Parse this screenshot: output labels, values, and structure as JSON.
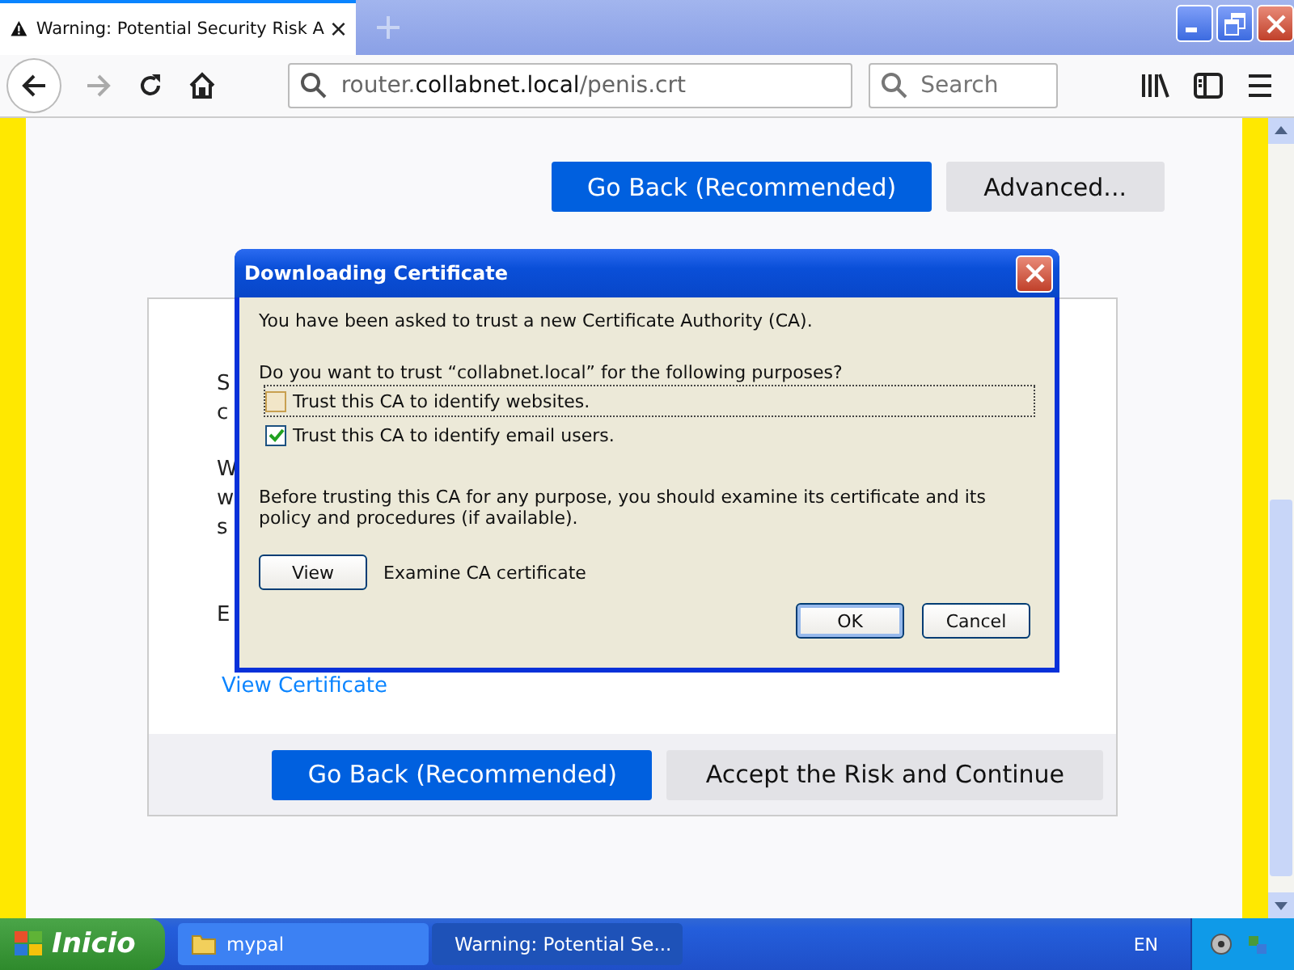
{
  "tab": {
    "title": "Warning: Potential Security Risk A",
    "selected": true
  },
  "url": {
    "host_prefix": "router.",
    "host": "collabnet.local",
    "path": "/penis.crt"
  },
  "search": {
    "placeholder": "Search"
  },
  "top_buttons": [
    {
      "label": "Go Back (Recommended)",
      "kind": "primary"
    },
    {
      "label": "Advanced...",
      "kind": "secondary"
    }
  ],
  "panel": {
    "fragments": [
      "S",
      "c",
      "W",
      "w",
      "s",
      "E"
    ],
    "link": "View Certificate",
    "buttons": [
      {
        "label": "Go Back (Recommended)",
        "kind": "primary"
      },
      {
        "label": "Accept the Risk and Continue",
        "kind": "secondary"
      }
    ]
  },
  "dialog": {
    "title": "Downloading Certificate",
    "intro": "You have been asked to trust a new Certificate Authority (CA).",
    "question": "Do you want to trust “collabnet.local” for the following purposes?",
    "options": [
      {
        "label": "Trust this CA to identify websites.",
        "checked": false,
        "focused": true
      },
      {
        "label": "Trust this CA to identify email users.",
        "checked": true,
        "focused": false
      }
    ],
    "advice": "Before trusting this CA for any purpose, you should examine its certificate and its policy and procedures (if available).",
    "view_button": "View",
    "view_label": "Examine CA certificate",
    "buttons": [
      {
        "label": "OK",
        "default": true
      },
      {
        "label": "Cancel",
        "default": false
      }
    ]
  },
  "taskbar": {
    "start": "Inicio",
    "items": [
      {
        "label": "mypal",
        "selected": false,
        "kind": "folder"
      },
      {
        "label": "Warning: Potential Se...",
        "selected": true,
        "kind": "browser"
      }
    ],
    "language": "EN"
  }
}
